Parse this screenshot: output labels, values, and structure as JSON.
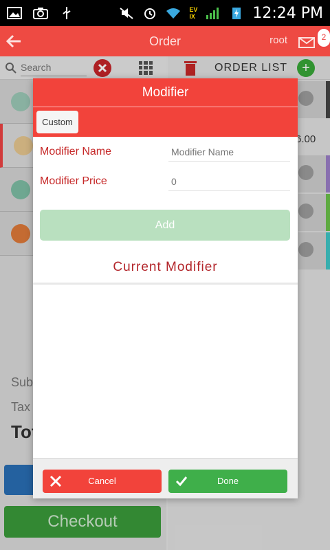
{
  "statusbar": {
    "time": "12:24 PM",
    "network_label": "EV\nIX"
  },
  "appbar": {
    "title": "Order",
    "user": "root",
    "badge": "2"
  },
  "left": {
    "search_placeholder": "Search",
    "totals": {
      "subtotal_label": "Sub",
      "tax_label": "Tax",
      "total_label": "Tot"
    },
    "checkout_label": "Checkout"
  },
  "right": {
    "order_list_title": "ORDER LIST",
    "price_peek": "6.00"
  },
  "dialog": {
    "title": "Modifier",
    "tab_custom": "Custom",
    "name_label": "Modifier Name",
    "name_placeholder": "Modifier Name",
    "price_label": "Modifier Price",
    "price_placeholder": "0",
    "add_label": "Add",
    "current_label": "Current Modifier",
    "cancel_label": "Cancel",
    "done_label": "Done"
  },
  "colors": {
    "accent": "#f2433b",
    "success": "#3faf4a",
    "text_red": "#c62828"
  }
}
